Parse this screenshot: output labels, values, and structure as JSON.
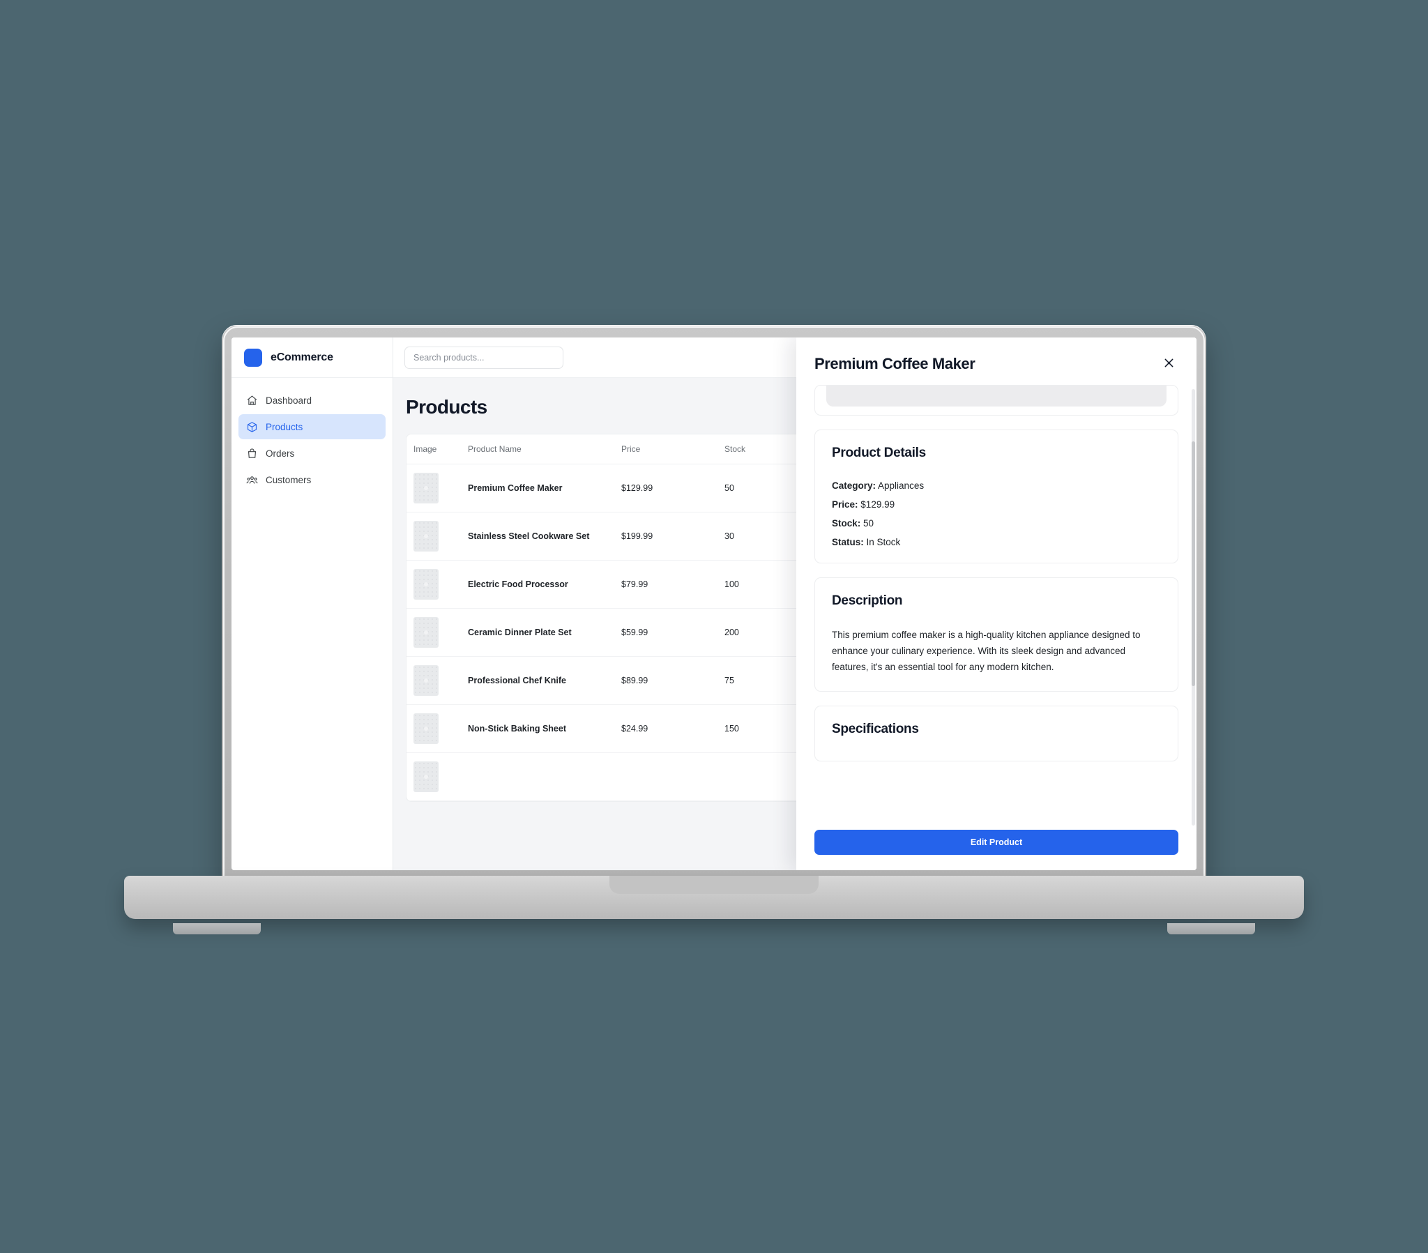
{
  "background_color": "#4c6670",
  "accent_color": "#2563eb",
  "brand": {
    "name": "eCommerce",
    "logo_icon": "rounded-square-logo"
  },
  "sidebar": {
    "items": [
      {
        "label": "Dashboard",
        "icon": "home-icon",
        "active": false
      },
      {
        "label": "Products",
        "icon": "box-icon",
        "active": true
      },
      {
        "label": "Orders",
        "icon": "bag-icon",
        "active": false
      },
      {
        "label": "Customers",
        "icon": "users-icon",
        "active": false
      }
    ]
  },
  "topbar": {
    "search_placeholder": "Search products...",
    "search_value": ""
  },
  "main": {
    "page_title": "Products",
    "table": {
      "columns": [
        "Image",
        "Product Name",
        "Price",
        "Stock"
      ],
      "rows": [
        {
          "image": "product-thumbnail-placeholder",
          "name": "Premium Coffee Maker",
          "price": "$129.99",
          "stock": "50"
        },
        {
          "image": "product-thumbnail-placeholder",
          "name": "Stainless Steel Cookware Set",
          "price": "$199.99",
          "stock": "30"
        },
        {
          "image": "product-thumbnail-placeholder",
          "name": "Electric Food Processor",
          "price": "$79.99",
          "stock": "100"
        },
        {
          "image": "product-thumbnail-placeholder",
          "name": "Ceramic Dinner Plate Set",
          "price": "$59.99",
          "stock": "200"
        },
        {
          "image": "product-thumbnail-placeholder",
          "name": "Professional Chef Knife",
          "price": "$89.99",
          "stock": "75"
        },
        {
          "image": "product-thumbnail-placeholder",
          "name": "Non-Stick Baking Sheet",
          "price": "$24.99",
          "stock": "150"
        },
        {
          "image": "product-thumbnail-placeholder",
          "name": "",
          "price": "",
          "stock": ""
        }
      ]
    }
  },
  "detail_panel": {
    "title": "Premium Coffee Maker",
    "close_icon": "close-icon",
    "product_details": {
      "heading": "Product Details",
      "category_label": "Category:",
      "category_value": "Appliances",
      "price_label": "Price:",
      "price_value": "$129.99",
      "stock_label": "Stock:",
      "stock_value": "50",
      "status_label": "Status:",
      "status_value": "In Stock"
    },
    "description": {
      "heading": "Description",
      "text": "This premium coffee maker is a high-quality kitchen appliance designed to enhance your culinary experience. With its sleek design and advanced features, it's an essential tool for any modern kitchen."
    },
    "specifications": {
      "heading": "Specifications"
    },
    "edit_button_label": "Edit Product"
  }
}
